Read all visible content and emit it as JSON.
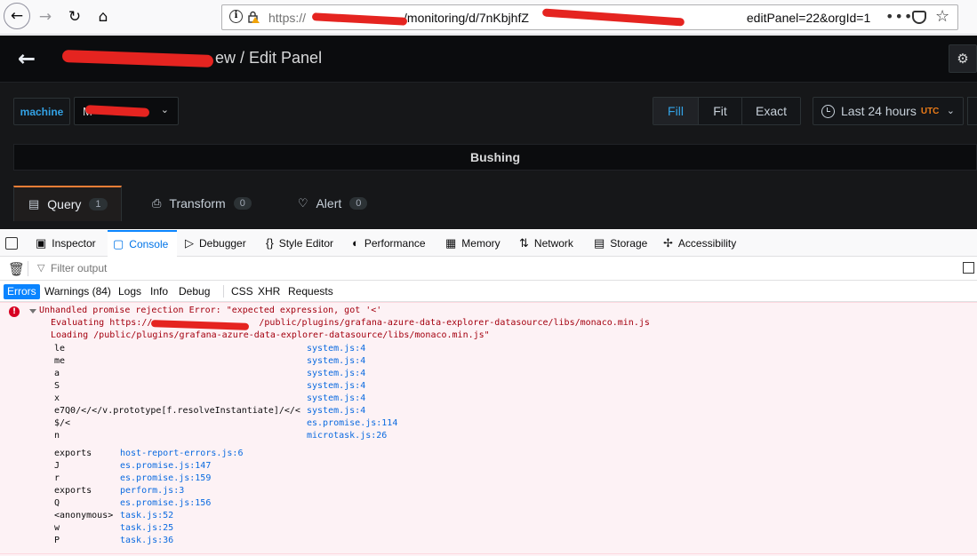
{
  "browser": {
    "url_scheme": "https://",
    "url_mid": "/monitoring/d/7nKbjhfZ",
    "url_end": "editPanel=22&orgId=1",
    "more_label": "•••"
  },
  "grafana": {
    "title": "ew / Edit Panel",
    "variable": {
      "label": "machine",
      "value": "M"
    },
    "size_buttons": {
      "fill": "Fill",
      "fit": "Fit",
      "exact": "Exact"
    },
    "time_range": {
      "label": "Last 24 hours",
      "tz": "UTC"
    },
    "panel_title": "Bushing",
    "tabs": {
      "query": {
        "label": "Query",
        "count": "1"
      },
      "transform": {
        "label": "Transform",
        "count": "0"
      },
      "alert": {
        "label": "Alert",
        "count": "0"
      }
    }
  },
  "devtools": {
    "tabs": {
      "inspector": "Inspector",
      "console": "Console",
      "debugger": "Debugger",
      "style_editor": "Style Editor",
      "performance": "Performance",
      "memory": "Memory",
      "network": "Network",
      "storage": "Storage",
      "accessibility": "Accessibility"
    },
    "filter_placeholder": "Filter output",
    "categories": {
      "errors": "Errors",
      "warnings": "Warnings (84)",
      "logs": "Logs",
      "info": "Info",
      "debug": "Debug",
      "css": "CSS",
      "xhr": "XHR",
      "requests": "Requests"
    },
    "error": {
      "line1": "Unhandled promise rejection Error: \"expected expression, got '<'",
      "line2_a": "Evaluating https://",
      "line2_b": "/public/plugins/grafana-azure-data-explorer-datasource/libs/monaco.min.js",
      "line3": "Loading /public/plugins/grafana-azure-data-explorer-datasource/libs/monaco.min.js\"",
      "stack1": [
        {
          "fn": "le",
          "src": "system.js:4"
        },
        {
          "fn": "me",
          "src": "system.js:4"
        },
        {
          "fn": "a",
          "src": "system.js:4"
        },
        {
          "fn": "S",
          "src": "system.js:4"
        },
        {
          "fn": "x",
          "src": "system.js:4"
        },
        {
          "fn": "e7Q0/</</v.prototype[f.resolveInstantiate]/</<",
          "src": "system.js:4"
        },
        {
          "fn": "$/<",
          "src": "es.promise.js:114"
        },
        {
          "fn": "n",
          "src": "microtask.js:26"
        }
      ],
      "stack2": [
        {
          "fn": "exports",
          "src": "host-report-errors.js:6"
        },
        {
          "fn": "J",
          "src": "es.promise.js:147"
        },
        {
          "fn": "r",
          "src": "es.promise.js:159"
        },
        {
          "fn": "exports",
          "src": "perform.js:3"
        },
        {
          "fn": "Q",
          "src": "es.promise.js:156"
        },
        {
          "fn": "<anonymous>",
          "src": "task.js:52"
        },
        {
          "fn": "w",
          "src": "task.js:25"
        },
        {
          "fn": "P",
          "src": "task.js:36"
        }
      ]
    }
  }
}
